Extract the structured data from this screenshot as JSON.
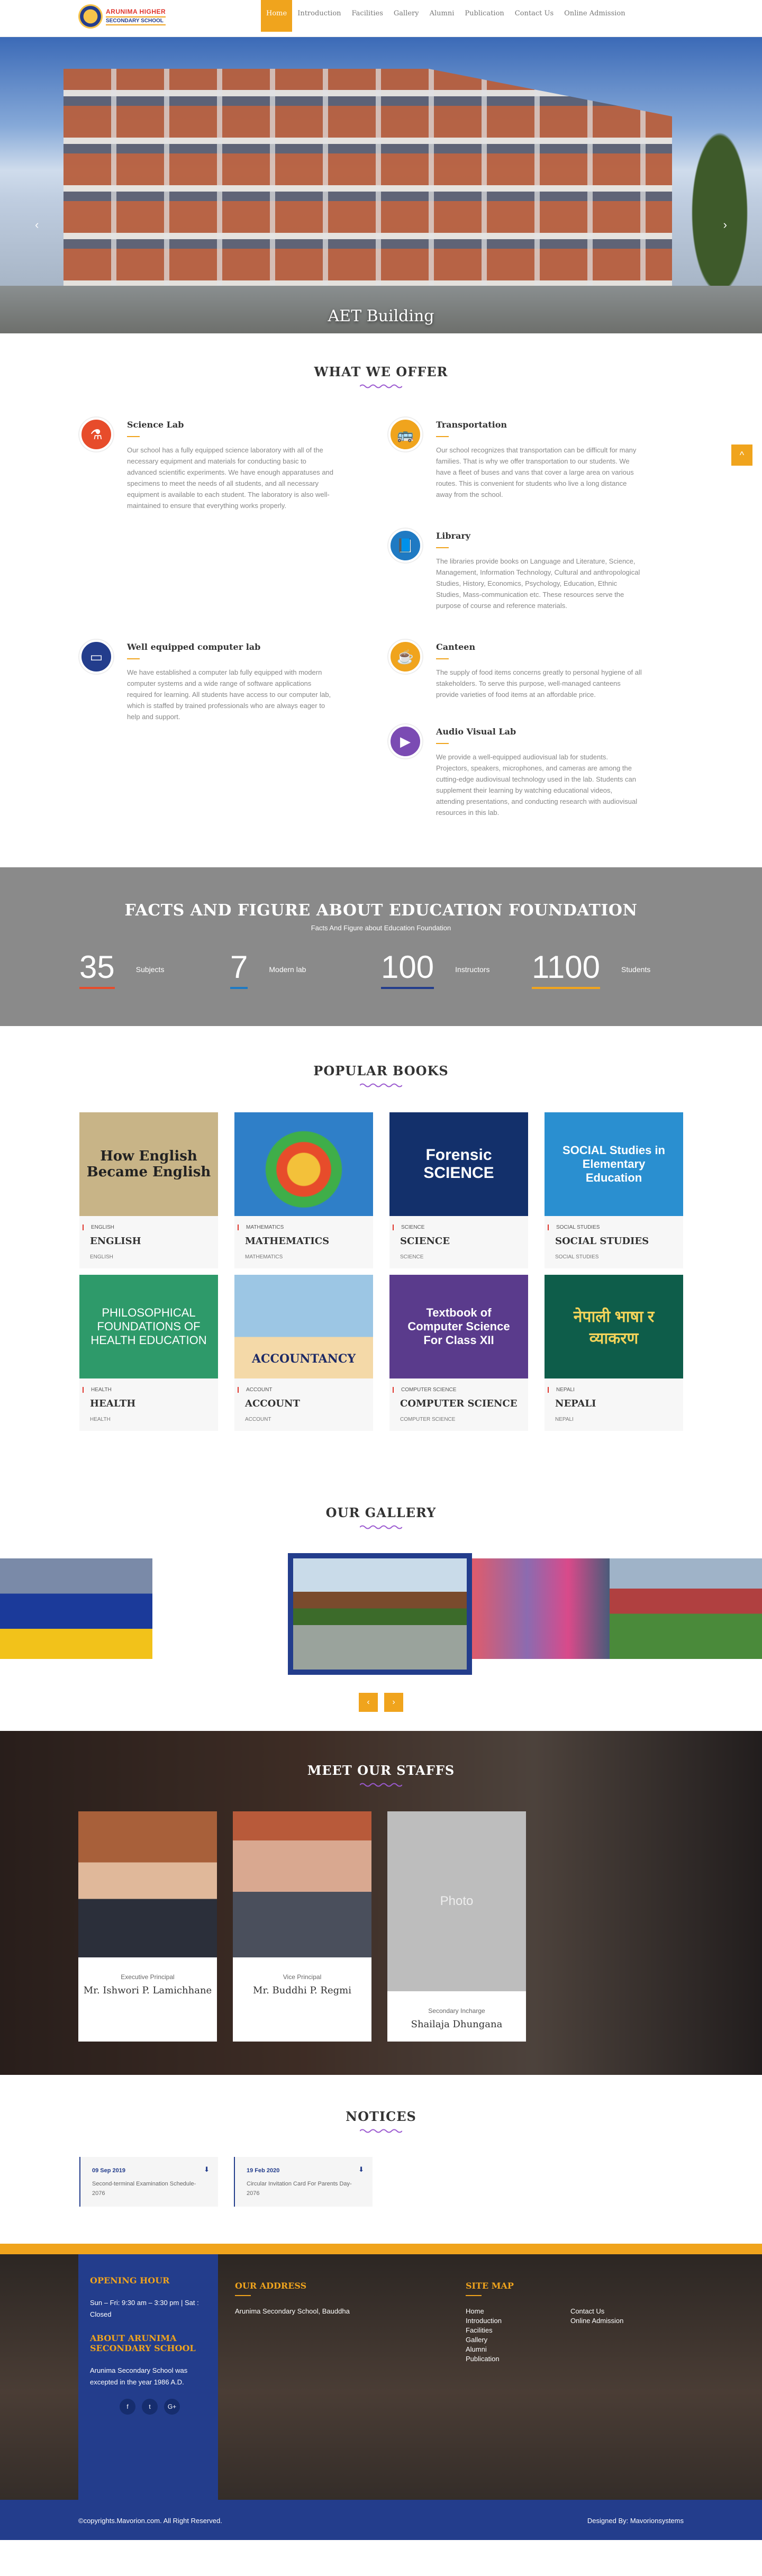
{
  "header": {
    "logo_line1": "ARUNIMA HIGHER",
    "logo_line2": "SECONDARY SCHOOL",
    "nav": [
      "Home",
      "Introduction",
      "Facilities",
      "Gallery",
      "Alumni",
      "Publication",
      "Contact Us",
      "Online Admission"
    ]
  },
  "hero": {
    "caption": "AET Building",
    "prev": "‹",
    "next": "›"
  },
  "offers": {
    "title": "WHAT WE OFFER",
    "items": [
      {
        "title": "Science Lab",
        "icon": "flask-icon",
        "color": "#e74c2b",
        "text": "Our school has a fully equipped science laboratory with all of the necessary equipment and materials for conducting basic to advanced scientific experiments. We have enough apparatuses and specimens to meet the needs of all students, and all necessary equipment is available to each student. The laboratory is also well-maintained to ensure that everything works properly."
      },
      {
        "title": "Transportation",
        "icon": "bus-icon",
        "color": "#f0a41d",
        "text": "Our school recognizes that transportation can be difficult for many families. That is why we offer transportation to our students. We have a fleet of buses and vans that cover a large area on various routes. This is convenient for students who live a long distance away from the school."
      },
      {
        "title": "Library",
        "icon": "book-icon",
        "color": "#1f7ac3",
        "text": "The libraries provide books on Language and Literature, Science, Management, Information Technology, Cultural and anthropological Studies, History, Economics, Psychology, Education, Ethnic Studies, Mass-communication etc. These resources serve the purpose of course and reference materials."
      },
      {
        "title": "Well equipped computer lab",
        "icon": "monitor-icon",
        "color": "#233d8c",
        "text": "We have established a computer lab fully equipped with modern computer systems and a wide range of software applications required for learning. All students have access to our computer lab, which is staffed by trained professionals who are always eager to help and support."
      },
      {
        "title": "Canteen",
        "icon": "cup-icon",
        "color": "#f0a41d",
        "text": "The supply of food items concerns greatly to personal hygiene of all stakeholders. To serve this purpose, well-managed canteens provide varieties of food items at an affordable price."
      },
      {
        "title": "Audio Visual Lab",
        "icon": "video-icon",
        "color": "#7b4bb3",
        "text": "We provide a well-equipped audiovisual lab for students. Projectors, speakers, microphones, and cameras are among the cutting-edge audiovisual technology used in the lab. Students can supplement their learning by watching educational videos, attending presentations, and conducting research with audiovisual resources in this lab."
      }
    ],
    "float_btn": "^"
  },
  "facts": {
    "title": "FACTS AND FIGURE ABOUT EDUCATION FOUNDATION",
    "subtitle": "Facts And Figure about Education Foundation",
    "items": [
      {
        "num": "35",
        "label": "Subjects",
        "color": "#e74c2b"
      },
      {
        "num": "7",
        "label": "Modern lab",
        "color": "#1f7ac3"
      },
      {
        "num": "100",
        "label": "Instructors",
        "color": "#233d8c"
      },
      {
        "num": "1100",
        "label": "Students",
        "color": "#f0a41d"
      }
    ]
  },
  "books": {
    "title": "POPULAR BOOKS",
    "items": [
      {
        "cat": "ENGLISH",
        "name": "ENGLISH",
        "sub": "ENGLISH",
        "cover_text": "How English Became English",
        "bg": "#c8b487",
        "fg": "#222"
      },
      {
        "cat": "MATHEMATICS",
        "name": "MATHEMATICS",
        "sub": "MATHEMATICS",
        "cover_text": "",
        "bg": "#2f7fc8",
        "fg": "#fff"
      },
      {
        "cat": "SCIENCE",
        "name": "SCIENCE",
        "sub": "SCIENCE",
        "cover_text": "Forensic SCIENCE",
        "bg": "#13306b",
        "fg": "#fff"
      },
      {
        "cat": "SOCIAL STUDIES",
        "name": "SOCIAL STUDIES",
        "sub": "SOCIAL STUDIES",
        "cover_text": "SOCIAL Studies in Elementary Education",
        "bg": "#2a8fd0",
        "fg": "#fff"
      },
      {
        "cat": "HEALTH",
        "name": "HEALTH",
        "sub": "HEALTH",
        "cover_text": "PHILOSOPHICAL FOUNDATIONS OF HEALTH EDUCATION",
        "bg": "#2e9a6a",
        "fg": "#fff"
      },
      {
        "cat": "ACCOUNT",
        "name": "ACCOUNT",
        "sub": "ACCOUNT",
        "cover_text": "ACCOUNTANCY",
        "bg": "#9cc6e4",
        "fg": "#1d2a66"
      },
      {
        "cat": "COMPUTER SCIENCE",
        "name": "COMPUTER SCIENCE",
        "sub": "COMPUTER SCIENCE",
        "cover_text": "Textbook of Computer Science For Class XII",
        "bg": "#5a3b8c",
        "fg": "#fff"
      },
      {
        "cat": "NEPALI",
        "name": "NEPALI",
        "sub": "NEPALI",
        "cover_text": "नेपाली भाषा र व्याकरण",
        "bg": "#0e5d4a",
        "fg": "#f3d35a"
      }
    ]
  },
  "gallery": {
    "title": "OUR GALLERY",
    "prev": "‹",
    "next": "›"
  },
  "staff": {
    "title": "MEET OUR STAFFS",
    "members": [
      {
        "role": "Executive Principal",
        "name": "Mr. Ishwori P. Lamichhane"
      },
      {
        "role": "Vice Principal",
        "name": "Mr. Buddhi P. Regmi"
      },
      {
        "role": "Secondary Incharge",
        "name": "Shailaja Dhungana",
        "photo_text": "Photo"
      }
    ]
  },
  "notices": {
    "title": "NOTICES",
    "items": [
      {
        "date": "09 Sep 2019",
        "text": "Second-terminal Examination Schedule-2076"
      },
      {
        "date": "19 Feb 2020",
        "text": "Circular Invitation Card For Parents Day- 2076"
      }
    ]
  },
  "footer": {
    "opening_title": "OPENING HOUR",
    "opening_text": "Sun – Fri: 9:30 am – 3:30 pm | Sat : Closed",
    "about_title": "ABOUT ARUNIMA SECONDARY SCHOOL",
    "about_text": "Arunima Secondary School was excepted in the year 1986 A.D.",
    "social": [
      "f",
      "t",
      "G+"
    ],
    "address_title": "OUR ADDRESS",
    "address_text": "Arunima Secondary School, Bauddha",
    "sitemap_title": "SITE MAP",
    "sitemap_col1": [
      "Home",
      "Introduction",
      "Facilities",
      "Gallery",
      "Alumni",
      "Publication"
    ],
    "sitemap_col2": [
      "Contact Us",
      "Online Admission"
    ],
    "copyright": "©copyrights.Mavorion.com. All Right Reserved.",
    "designed_by": "Designed By: Mavorionsystems"
  }
}
